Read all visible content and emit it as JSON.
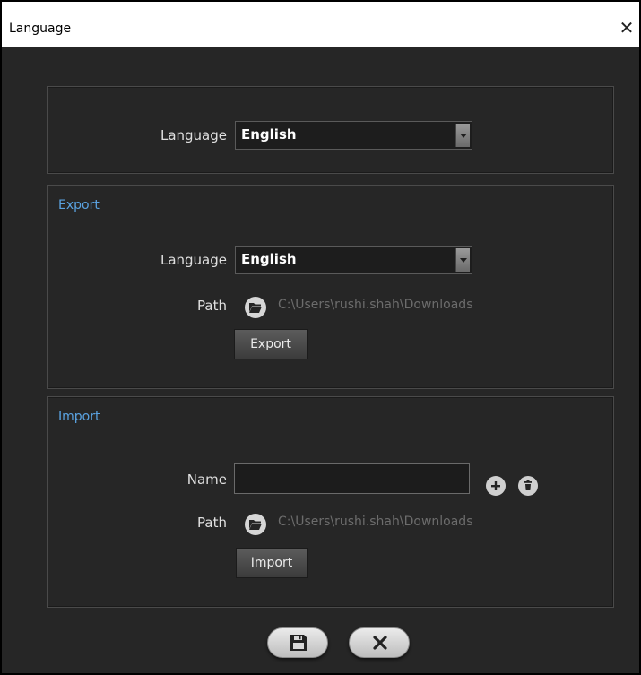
{
  "window": {
    "title": "Language",
    "close_glyph": "✕"
  },
  "language_panel": {
    "label": "Language",
    "selected": "English"
  },
  "export_panel": {
    "header": "Export",
    "language_label": "Language",
    "language_selected": "English",
    "path_label": "Path",
    "path_value": "C:\\Users\\rushi.shah\\Downloads",
    "button_label": "Export"
  },
  "import_panel": {
    "header": "Import",
    "name_label": "Name",
    "name_value": "",
    "path_label": "Path",
    "path_value": "C:\\Users\\rushi.shah\\Downloads",
    "button_label": "Import"
  },
  "footer": {
    "save_icon": "floppy-disk-icon",
    "cancel_icon": "x-icon"
  },
  "colors": {
    "background": "#262626",
    "section_header": "#5aa2e0",
    "path_text": "#6c6c6c"
  }
}
